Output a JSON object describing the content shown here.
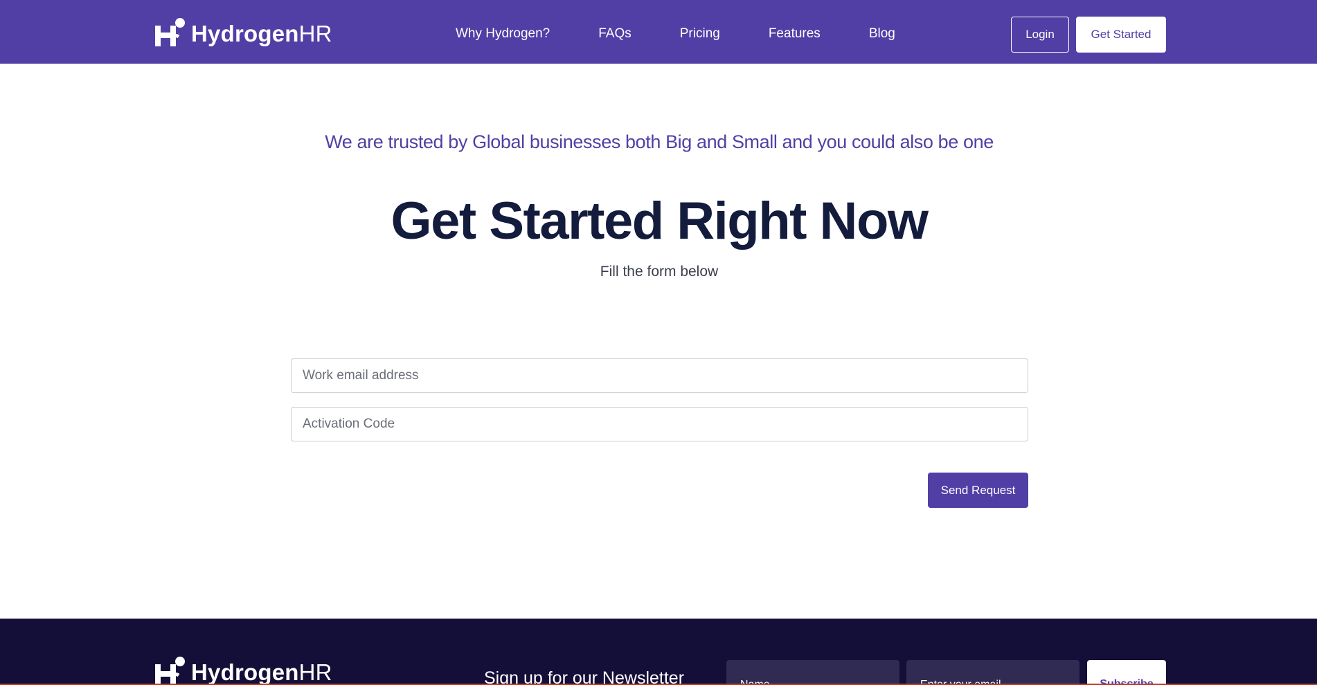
{
  "header": {
    "logo_bold": "Hydrogen",
    "logo_light": "HR",
    "nav": [
      {
        "label": "Why Hydrogen?"
      },
      {
        "label": "FAQs"
      },
      {
        "label": "Pricing"
      },
      {
        "label": "Features"
      },
      {
        "label": "Blog"
      }
    ],
    "login_label": "Login",
    "get_started_label": "Get Started"
  },
  "hero": {
    "trusted_text": "We are trusted by Global businesses both Big and Small and you could also be one",
    "title": "Get Started Right Now",
    "subtitle": "Fill the form below"
  },
  "form": {
    "email_placeholder": "Work email address",
    "email_value": "",
    "code_placeholder": "Activation Code",
    "code_value": "",
    "send_label": "Send Request"
  },
  "footer": {
    "logo_bold": "Hydrogen",
    "logo_light": "HR",
    "newsletter_title": "Sign up for our Newsletter",
    "name_placeholder": "Name",
    "email_placeholder": "Enter your email",
    "subscribe_label": "Subscribe"
  },
  "colors": {
    "brand": "#513fa5",
    "footer_bg": "#130f38",
    "heading": "#131c3c"
  }
}
